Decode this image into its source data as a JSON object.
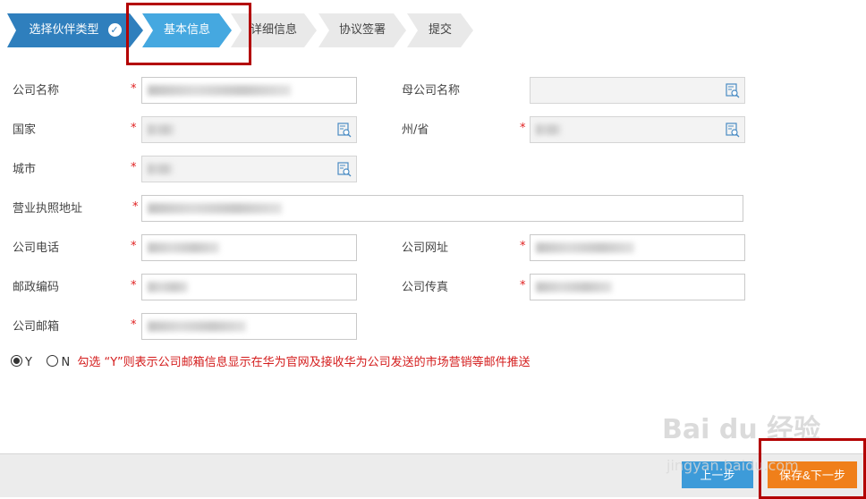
{
  "wizard": {
    "steps": [
      {
        "label": "选择伙伴类型",
        "state": "done"
      },
      {
        "label": "基本信息",
        "state": "current"
      },
      {
        "label": "详细信息",
        "state": "todo"
      },
      {
        "label": "协议签署",
        "state": "todo"
      },
      {
        "label": "提交",
        "state": "todo"
      }
    ],
    "done_icon": "check-icon"
  },
  "form": {
    "company_name": {
      "label": "公司名称",
      "required": "*"
    },
    "parent_company": {
      "label": "母公司名称"
    },
    "country": {
      "label": "国家",
      "required": "*"
    },
    "province": {
      "label": "州/省",
      "required": "*"
    },
    "city": {
      "label": "城市",
      "required": "*"
    },
    "license_address": {
      "label": "营业执照地址",
      "required": "*"
    },
    "phone": {
      "label": "公司电话",
      "required": "*"
    },
    "website": {
      "label": "公司网址",
      "required": "*"
    },
    "postcode": {
      "label": "邮政编码",
      "required": "*"
    },
    "fax": {
      "label": "公司传真",
      "required": "*"
    },
    "email": {
      "label": "公司邮箱",
      "required": "*"
    }
  },
  "email_consent": {
    "yes_label": "Y",
    "no_label": "N",
    "selected": "Y",
    "notice": "勾选 “Y”则表示公司邮箱信息显示在华为官网及接收华为公司发送的市场营销等邮件推送"
  },
  "footer": {
    "prev_label": "上一步",
    "next_label": "保存&下一步"
  },
  "watermark": {
    "logo": "Bai du 经验",
    "url": "jingyan.baidu.com"
  },
  "colors": {
    "step_done": "#2f7fbd",
    "step_current": "#45a8e0",
    "required": "#e02020",
    "notice": "#d41c1c",
    "prev_button": "#3d9bd9",
    "next_button": "#f07f1a",
    "highlight": "#b30000"
  }
}
